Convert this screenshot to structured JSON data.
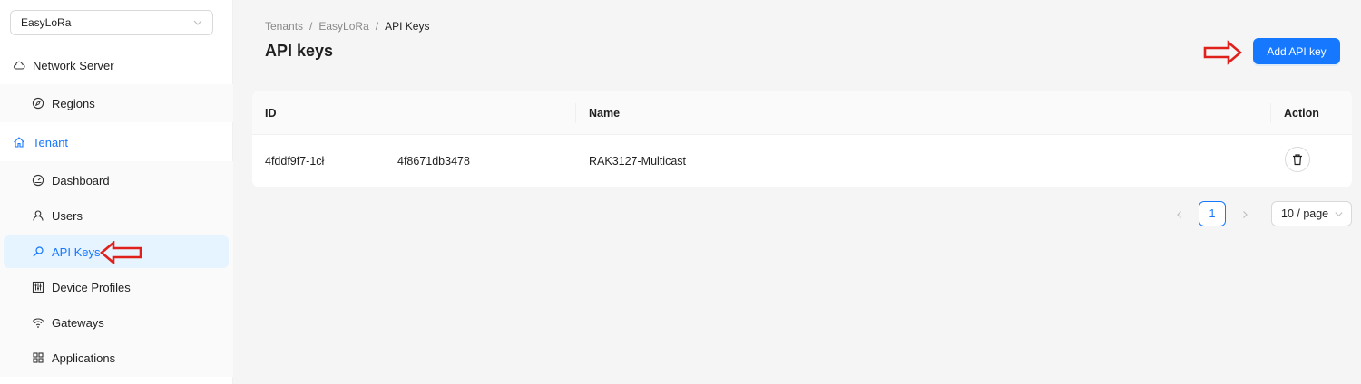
{
  "sidebar": {
    "tenant_select": {
      "value": "EasyLoRa",
      "icon": "chevron-down-icon"
    },
    "network_server": {
      "label": "Network Server",
      "icon": "cloud-icon"
    },
    "regions": {
      "label": "Regions",
      "icon": "compass-icon"
    },
    "tenant": {
      "label": "Tenant",
      "icon": "home-icon"
    },
    "items": [
      {
        "label": "Dashboard",
        "icon": "dashboard-icon"
      },
      {
        "label": "Users",
        "icon": "user-icon"
      },
      {
        "label": "API Keys",
        "icon": "key-icon",
        "active": true
      },
      {
        "label": "Device Profiles",
        "icon": "sliders-icon"
      },
      {
        "label": "Gateways",
        "icon": "wifi-icon"
      },
      {
        "label": "Applications",
        "icon": "appstore-icon"
      }
    ]
  },
  "breadcrumb": [
    "Tenants",
    "EasyLoRa",
    "API Keys"
  ],
  "breadcrumb_sep": "/",
  "page_title": "API keys",
  "add_button": "Add API key",
  "table": {
    "columns": {
      "id": "ID",
      "name": "Name",
      "action": "Action"
    },
    "rows": [
      {
        "id_part1": "4fddf9f7-1cł",
        "id_part2": "4f8671db3478",
        "name": "RAK3127-Multicast",
        "action_icon": "delete-icon"
      }
    ]
  },
  "pagination": {
    "current_page": "1",
    "page_size": "10 / page"
  },
  "colors": {
    "primary": "#1677ff",
    "annotation_arrow": "#e0201a",
    "active_bg": "#e6f4ff"
  }
}
